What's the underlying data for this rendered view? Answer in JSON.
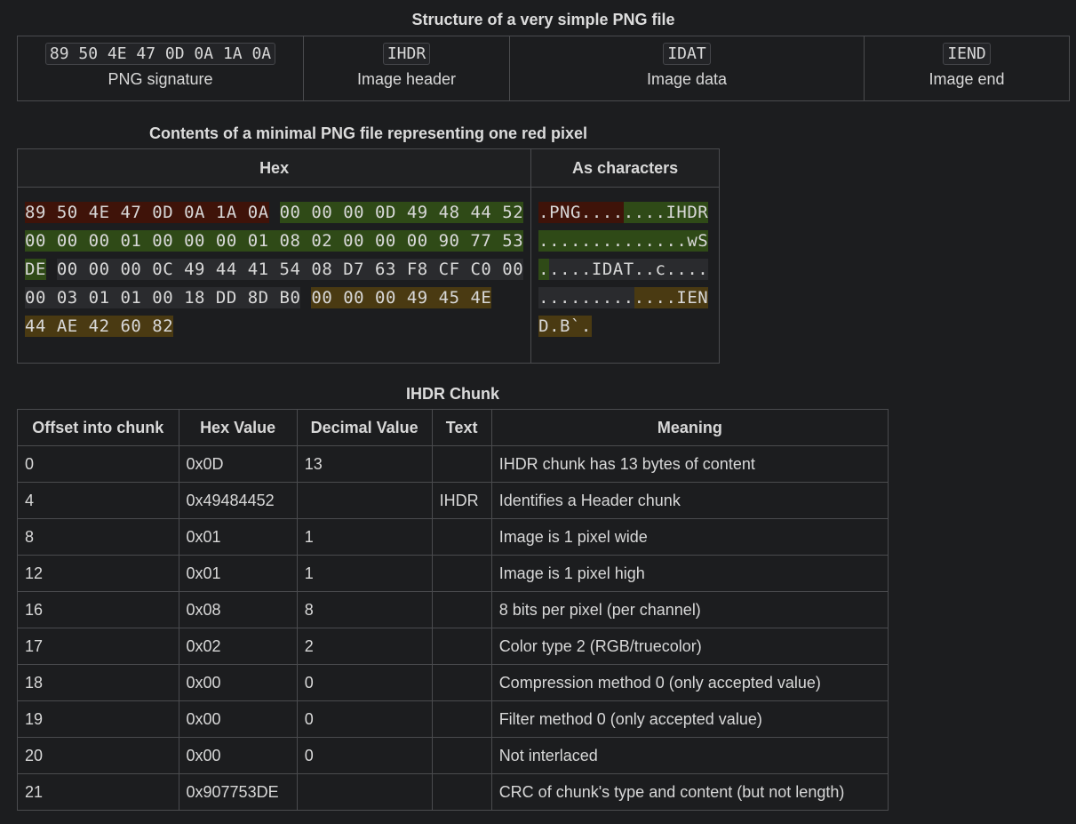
{
  "structure": {
    "title": "Structure of a very simple PNG file",
    "parts": [
      {
        "code": "89 50 4E 47 0D 0A 1A 0A",
        "label": "PNG signature"
      },
      {
        "code": "IHDR",
        "label": "Image header"
      },
      {
        "code": "IDAT",
        "label": "Image data"
      },
      {
        "code": "IEND",
        "label": "Image end"
      }
    ]
  },
  "contents": {
    "title": "Contents of a minimal PNG file representing one red pixel",
    "headers": [
      "Hex",
      "As characters"
    ],
    "colors": {
      "red": "#3f1309",
      "green": "#2f4a17",
      "gray": "#2a2b2e",
      "yellow": "#4a3a12"
    },
    "hex": [
      [
        {
          "t": "89 50 4E 47 0D 0A 1A 0A",
          "c": "red"
        },
        {
          "t": " ",
          "c": ""
        },
        {
          "t": "00 00 00 0D 49 48 44 52",
          "c": "green"
        }
      ],
      [
        {
          "t": "00 00 00 01 00 00 00 01 08 02 00 00 00 90 77 53",
          "c": "green"
        }
      ],
      [
        {
          "t": "DE",
          "c": "green"
        },
        {
          "t": " ",
          "c": ""
        },
        {
          "t": "00 00 00 0C 49 44 41 54 08 D7 63 F8 CF C0 00",
          "c": "gray"
        }
      ],
      [
        {
          "t": "00 03 01 01 00 18 DD 8D B0",
          "c": "gray"
        },
        {
          "t": " ",
          "c": ""
        },
        {
          "t": "00 00 00 49 45 4E",
          "c": "yellow"
        }
      ],
      [
        {
          "t": "44 AE 42 60 82",
          "c": "yellow"
        }
      ]
    ],
    "chars": [
      [
        {
          "t": ".PNG....",
          "c": "red"
        },
        {
          "t": "....IHDR",
          "c": "green"
        }
      ],
      [
        {
          "t": "..............wS",
          "c": "green"
        }
      ],
      [
        {
          "t": ".",
          "c": "green"
        },
        {
          "t": "....IDAT..c....",
          "c": "gray"
        }
      ],
      [
        {
          "t": ".........",
          "c": "gray"
        },
        {
          "t": "....IEN",
          "c": "yellow"
        }
      ],
      [
        {
          "t": "D.B`.",
          "c": "yellow"
        }
      ]
    ]
  },
  "ihdr": {
    "title": "IHDR Chunk",
    "headers": [
      "Offset into chunk",
      "Hex Value",
      "Decimal Value",
      "Text",
      "Meaning"
    ],
    "rows": [
      [
        "0",
        "0x0D",
        "13",
        "",
        "IHDR chunk has 13 bytes of content"
      ],
      [
        "4",
        "0x49484452",
        "",
        "IHDR",
        "Identifies a Header chunk"
      ],
      [
        "8",
        "0x01",
        "1",
        "",
        "Image is 1 pixel wide"
      ],
      [
        "12",
        "0x01",
        "1",
        "",
        "Image is 1 pixel high"
      ],
      [
        "16",
        "0x08",
        "8",
        "",
        "8 bits per pixel (per channel)"
      ],
      [
        "17",
        "0x02",
        "2",
        "",
        "Color type 2 (RGB/truecolor)"
      ],
      [
        "18",
        "0x00",
        "0",
        "",
        "Compression method 0 (only accepted value)"
      ],
      [
        "19",
        "0x00",
        "0",
        "",
        "Filter method 0 (only accepted value)"
      ],
      [
        "20",
        "0x00",
        "0",
        "",
        "Not interlaced"
      ],
      [
        "21",
        "0x907753DE",
        "",
        "",
        "CRC of chunk's type and content (but not length)"
      ]
    ]
  }
}
